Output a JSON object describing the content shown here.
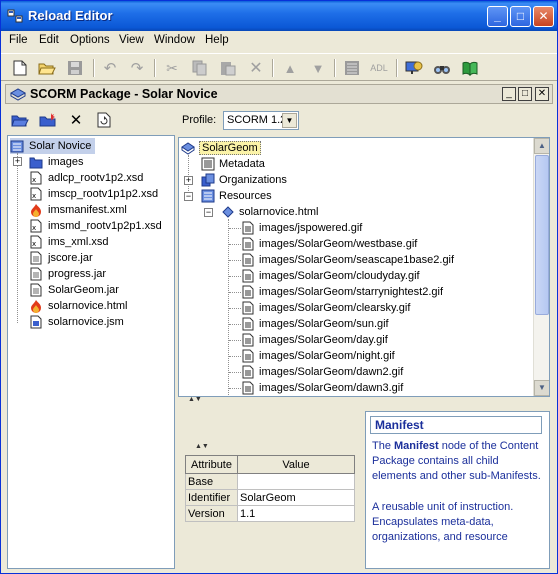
{
  "window": {
    "title": "Reload Editor"
  },
  "menu": [
    "File",
    "Edit",
    "Options",
    "View",
    "Window",
    "Help"
  ],
  "toolbar": {
    "adl_label": "ADL"
  },
  "package_title": "SCORM Package - Solar Novice",
  "files": {
    "root": "Solar Novice",
    "items": [
      {
        "label": "images",
        "icon": "folder-icon"
      },
      {
        "label": "adlcp_rootv1p2.xsd",
        "icon": "xsd-file-icon"
      },
      {
        "label": "imscp_rootv1p1p2.xsd",
        "icon": "xsd-file-icon"
      },
      {
        "label": "imsmanifest.xml",
        "icon": "xml-file-icon"
      },
      {
        "label": "imsmd_rootv1p2p1.xsd",
        "icon": "xsd-file-icon"
      },
      {
        "label": "ims_xml.xsd",
        "icon": "xsd-file-icon"
      },
      {
        "label": "jscore.jar",
        "icon": "jar-file-icon"
      },
      {
        "label": "progress.jar",
        "icon": "jar-file-icon"
      },
      {
        "label": "SolarGeom.jar",
        "icon": "jar-file-icon"
      },
      {
        "label": "solarnovice.html",
        "icon": "html-file-icon"
      },
      {
        "label": "solarnovice.jsm",
        "icon": "jsm-file-icon"
      }
    ]
  },
  "profile": {
    "label": "Profile:",
    "value": "SCORM 1.2"
  },
  "manifest_tree": {
    "root": "SolarGeom",
    "metadata": "Metadata",
    "organizations": "Organizations",
    "resources": "Resources",
    "resource": "solarnovice.html",
    "files": [
      "images/jspowered.gif",
      "images/SolarGeom/westbase.gif",
      "images/SolarGeom/seascape1base2.gif",
      "images/SolarGeom/cloudyday.gif",
      "images/SolarGeom/starrynightest2.gif",
      "images/SolarGeom/clearsky.gif",
      "images/SolarGeom/sun.gif",
      "images/SolarGeom/day.gif",
      "images/SolarGeom/night.gif",
      "images/SolarGeom/dawn2.gif",
      "images/SolarGeom/dawn3.gif"
    ]
  },
  "attributes": {
    "headers": [
      "Attribute",
      "Value"
    ],
    "rows": [
      {
        "key": "Base",
        "value": ""
      },
      {
        "key": "Identifier",
        "value": "SolarGeom"
      },
      {
        "key": "Version",
        "value": "1.1"
      }
    ]
  },
  "help": {
    "title": "Manifest",
    "line1_pre": "The ",
    "line1_bold": "Manifest",
    "line1_post": " node of the Content Package contains all child elements and other sub-Manifests.",
    "line2": "A reusable unit of instruction. Encapsulates meta-data, organizations, and resource"
  },
  "colors": {
    "titlebar": "#0b58d6",
    "help_text": "#1b2f9b",
    "selection": "#c3d0ea"
  }
}
